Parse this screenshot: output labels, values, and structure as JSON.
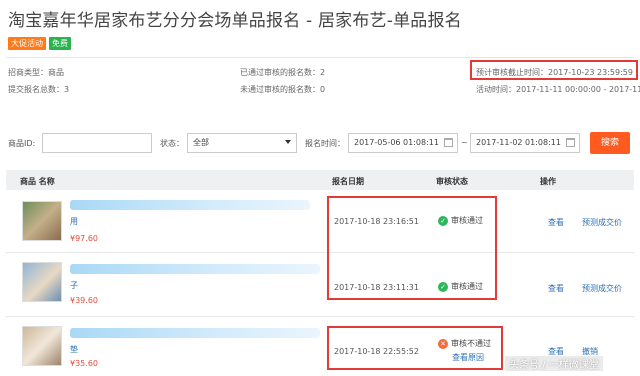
{
  "page": {
    "title": "淘宝嘉年华居家布艺分分会场单品报名 - 居家布艺-单品报名",
    "badges": [
      "大促活动",
      "免费"
    ]
  },
  "info": {
    "recruit_type_label": "招商类型：",
    "recruit_type_value": "商品",
    "submitted_label": "提交报名总数：",
    "submitted_value": "3",
    "approved_label": "已通过审核的报名数：",
    "approved_value": "2",
    "rejected_label": "未通过审核的报名数：",
    "rejected_value": "0",
    "deadline_label": "预计审核截止时间：",
    "deadline_value": "2017-10-23 23:59:59",
    "activity_time_label": "活动时间：",
    "activity_time_value": "2017-11-11 00:00:00 - 2017-11-"
  },
  "filters": {
    "product_id_label": "商品ID:",
    "product_id_value": "",
    "status_label": "状态：",
    "status_value": "全部",
    "signup_time_label": "报名时间：",
    "date_from": "2017-05-06 01:08:11",
    "date_sep": "~",
    "date_to": "2017-11-02 01:08:11",
    "search_label": "搜索"
  },
  "table": {
    "headers": [
      "商品 名称",
      "报名日期",
      "审核状态",
      "操作"
    ],
    "rows": [
      {
        "name": "用",
        "price": "¥97.60",
        "date": "2017-10-18 23:16:51",
        "status": "审核通过",
        "status_kind": "pass",
        "reason_link": "",
        "actions": [
          "查看",
          "预测成交价"
        ]
      },
      {
        "name": "子",
        "price": "¥39.60",
        "date": "2017-10-18 23:11:31",
        "status": "审核通过",
        "status_kind": "pass",
        "reason_link": "",
        "actions": [
          "查看",
          "预测成交价"
        ]
      },
      {
        "name": "垫",
        "price": "¥35.60",
        "date": "2017-10-18 22:55:52",
        "status": "审核不通过",
        "status_kind": "fail",
        "reason_link": "查看原因",
        "actions": [
          "查看",
          "撤销"
        ]
      }
    ]
  },
  "watermark": "头条号 / 一样微课堂",
  "colors": {
    "accent_orange": "#ff5a1f",
    "pass_green": "#2fb55c",
    "highlight_red": "#e53935",
    "link_blue": "#2a6fb5"
  }
}
